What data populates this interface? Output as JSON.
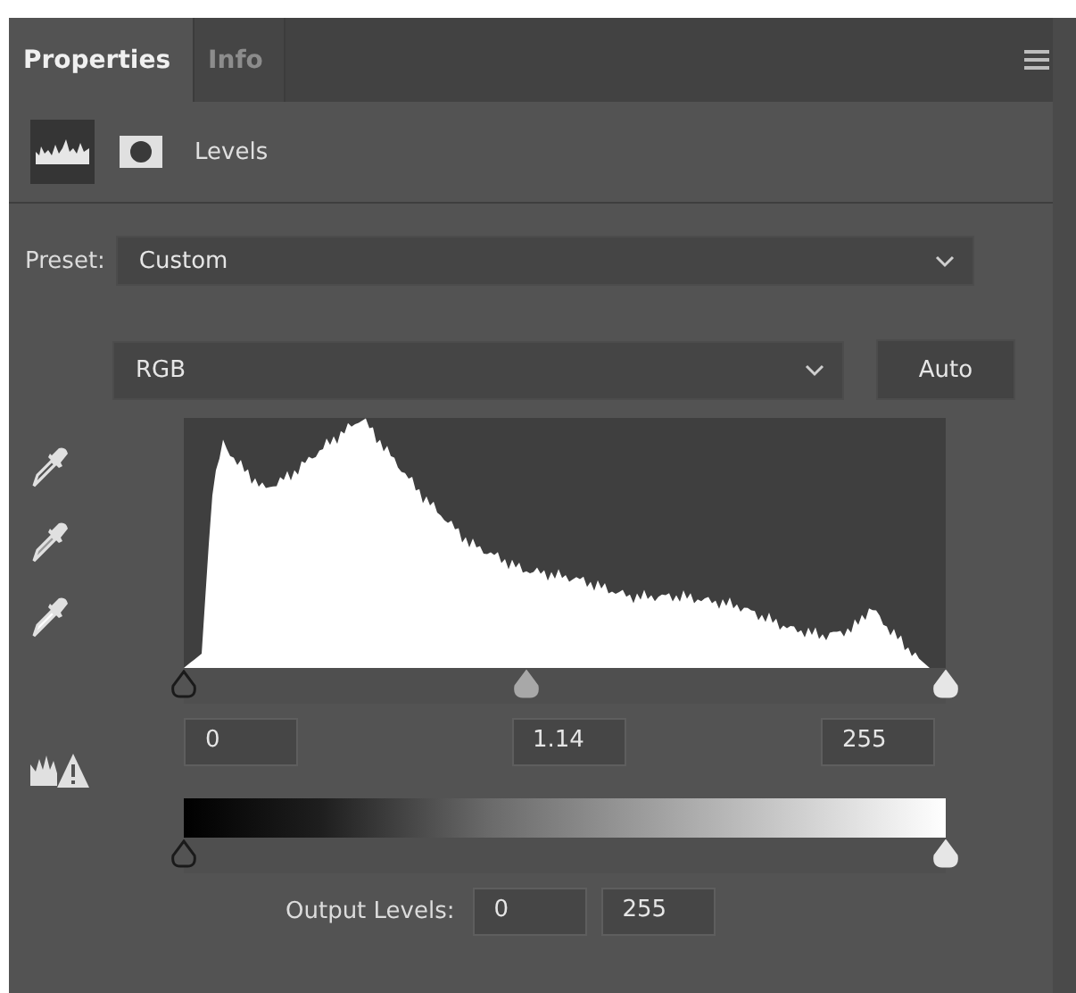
{
  "tabs": [
    {
      "label": "Properties",
      "selected": true
    },
    {
      "label": "Info",
      "selected": false
    }
  ],
  "header": {
    "modes": [
      {
        "kind": "adjustment",
        "selected": true
      },
      {
        "kind": "mask",
        "selected": false
      }
    ],
    "title": "Levels"
  },
  "preset": {
    "label": "Preset:",
    "value": "Custom"
  },
  "channel": {
    "value": "RGB"
  },
  "auto_button": "Auto",
  "input_thumbs": [
    {
      "kind": "black",
      "level": 0
    },
    {
      "kind": "gray",
      "level": 0.45
    },
    {
      "kind": "white",
      "level": 1
    }
  ],
  "input_values": [
    "0",
    "1.14",
    "255"
  ],
  "output_thumbs": [
    {
      "kind": "black",
      "level": 0
    },
    {
      "kind": "white",
      "level": 1
    }
  ],
  "output": {
    "label": "Output Levels:",
    "values": [
      "0",
      "255"
    ]
  }
}
